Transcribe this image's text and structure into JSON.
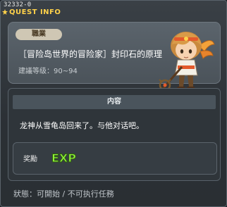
{
  "quest": {
    "id": "32332-0",
    "header": "QUEST INFO",
    "job_label": "職業",
    "title": "［冒险岛世界的冒险家］封印石的原理",
    "level": "建議等级：90~94",
    "content_label": "内容",
    "dialog": "龙神从雪龟岛回来了。与他对话吧。",
    "reward_label": "奖勵",
    "reward_exp": "EXP",
    "status": "狀態：可開始 / 不可执行任務"
  },
  "colors": {
    "title": "#ffd24a",
    "exp_green": "#8ef03a"
  }
}
